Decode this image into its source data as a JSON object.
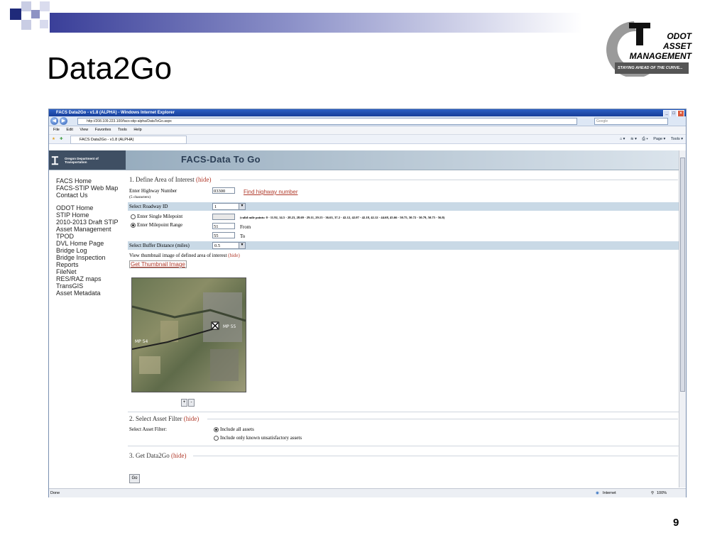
{
  "slide": {
    "title": "Data2Go",
    "page_number": "9",
    "logo": {
      "line1": "ODOT",
      "line2": "ASSET",
      "line3": "MANAGEMENT",
      "tagline": "STAYING AHEAD OF THE CURVE..."
    }
  },
  "browser": {
    "window_title": "FACS Data2Go - v1.8 (ALPHA) - Windows Internet Explorer",
    "address": "http://208.109.223.100/facs-stip-alpha/DataToGo.aspx",
    "search_placeholder": "Google",
    "menu": [
      "File",
      "Edit",
      "View",
      "Favorites",
      "Tools",
      "Help"
    ],
    "tab_label": "FACS Data2Go - v1.8 (ALPHA)",
    "command_items": [
      "Page ▾",
      "Tools ▾"
    ],
    "status_left": "Done",
    "status_zone": "Internet",
    "status_zoom": "100%"
  },
  "page": {
    "header_logo_text": "Oregon Department of Transportation",
    "header_title": "FACS-Data To Go",
    "sidebar": {
      "group1": [
        "FACS Home",
        "FACS-STIP Web Map",
        "Contact Us"
      ],
      "group2": [
        "ODOT Home",
        "STIP Home",
        "2010-2013 Draft STIP",
        "Asset Management",
        "TPOD",
        "DVL Home Page",
        "Bridge Log",
        "Bridge Inspection",
        "Reports",
        "FileNet",
        "RES/RAZ maps",
        "TransGIS",
        "Asset Metadata"
      ]
    },
    "section1": {
      "title": "1. Define Area of Interest",
      "hide": "(hide)",
      "highway_label": "Enter Highway Number",
      "highway_hint": "(5 characters)",
      "highway_value": "03300",
      "find_link": "Find highway number",
      "roadway_label": "Select Roadway ID",
      "roadway_value": "1",
      "single_mp_label": "Enter Single Milepoint",
      "valid_mp": "(valid mile points: 0 - 11.92, 14.5 - 28.23, 28.69 - 29.11, 29.15 - 36.63, 37.2 - 42.12, 42.07 - 42.18, 42.12 - 44.68, 45.66 - 50.75, 50.72 - 50.79, 50.75 - 56.8)",
      "range_label": "Enter Milepoint Range",
      "from_value": "51",
      "from_label": "From",
      "to_value": "55",
      "to_label": "To",
      "buffer_label": "Select Buffer Distance (miles)",
      "buffer_value": "0.5",
      "thumb_text": "View thumbnail image of defined area of interest",
      "thumb_hide": "(hide)",
      "thumb_link": "Get Thumbnail Image",
      "zoom_in": "+",
      "zoom_out": "-",
      "map_labels": [
        "MP 54",
        "MP 55"
      ]
    },
    "section2": {
      "title": "2. Select Asset Filter",
      "hide": "(hide)",
      "label": "Select Asset Filter:",
      "option_all": "Include all assets",
      "option_unsat": "Include only known unsatisfactory assets"
    },
    "section3": {
      "title": "3. Get Data2Go",
      "hide": "(hide)",
      "go": "Go"
    }
  },
  "colors": {
    "title_bar_blue": "#3a3f99",
    "link_red": "#b0392a",
    "band_blue": "#c9d9e6"
  }
}
